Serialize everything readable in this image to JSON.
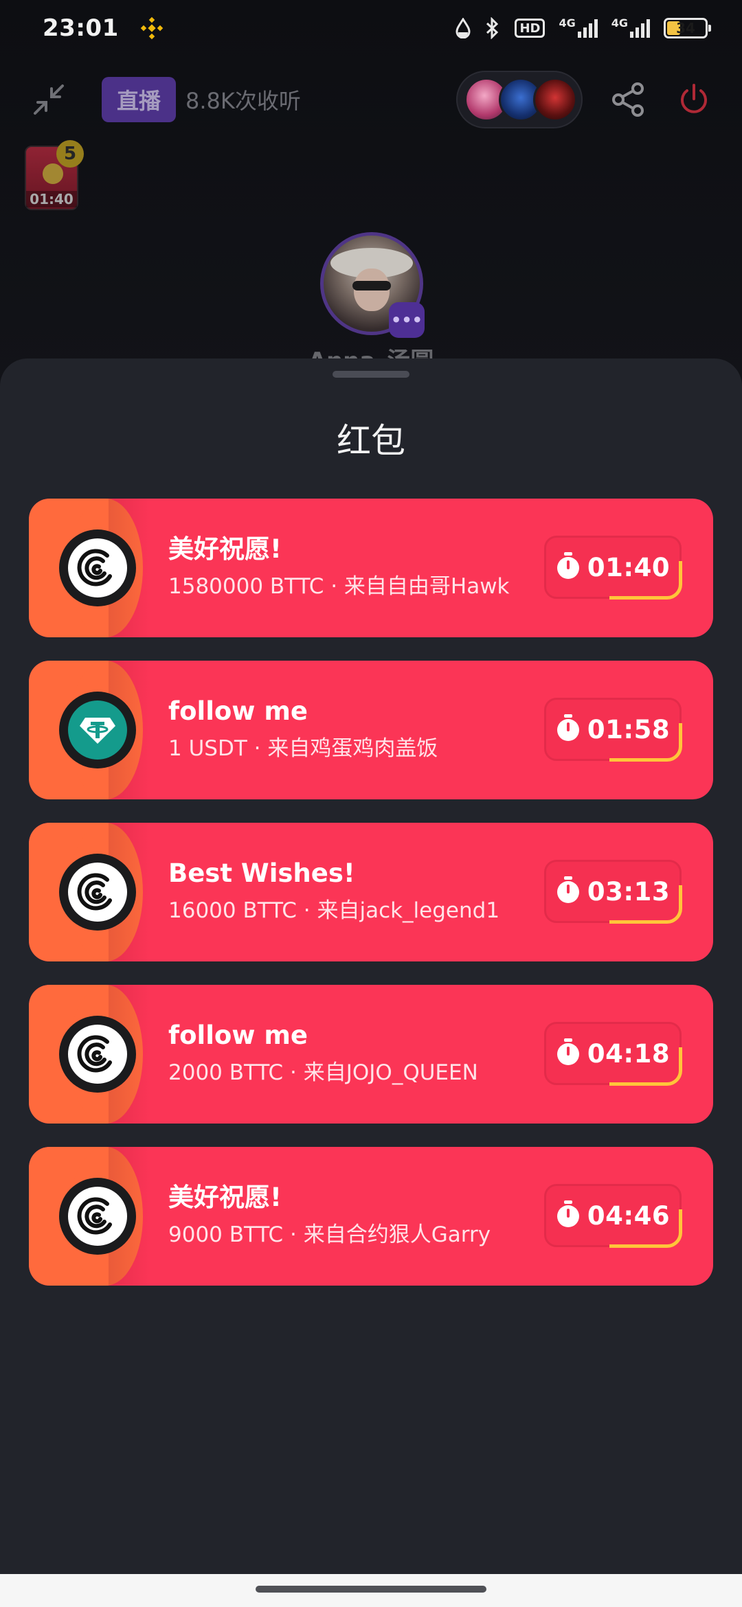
{
  "status_bar": {
    "time": "23:01",
    "hd_label": "HD",
    "net1": "4G",
    "net2": "4G",
    "battery": "34",
    "icons": [
      "binance-icon",
      "water-drop-icon",
      "bluetooth-icon",
      "hd-icon",
      "signal-icon",
      "signal-icon",
      "battery-icon"
    ]
  },
  "room": {
    "live_tag": "直播",
    "listen_count": "8.8K次收听",
    "host_name": "Anna_汤圆",
    "floating_envelope": {
      "badge": "5",
      "time": "01:40"
    }
  },
  "sheet": {
    "title": "红包",
    "packets": [
      {
        "title": "美好祝愿!",
        "subtitle": "1580000 BTTC · 来自自由哥Hawk",
        "timer": "01:40",
        "coin": "bttc"
      },
      {
        "title": "follow me",
        "subtitle": "1 USDT · 来自鸡蛋鸡肉盖饭",
        "timer": "01:58",
        "coin": "usdt"
      },
      {
        "title": "Best Wishes!",
        "subtitle": "16000 BTTC · 来自jack_legend1",
        "timer": "03:13",
        "coin": "bttc"
      },
      {
        "title": "follow me",
        "subtitle": "2000 BTTC · 来自JOJO_QUEEN",
        "timer": "04:18",
        "coin": "bttc"
      },
      {
        "title": "美好祝愿!",
        "subtitle": "9000 BTTC · 来自合约狠人Garry",
        "timer": "04:46",
        "coin": "bttc"
      }
    ]
  },
  "colors": {
    "packet_red": "#fb3556",
    "packet_orange": "#ff6a3d",
    "timer_arc": "#ffc53a",
    "sheet_bg": "#22242b",
    "live_purple": "#5b3aa6"
  }
}
